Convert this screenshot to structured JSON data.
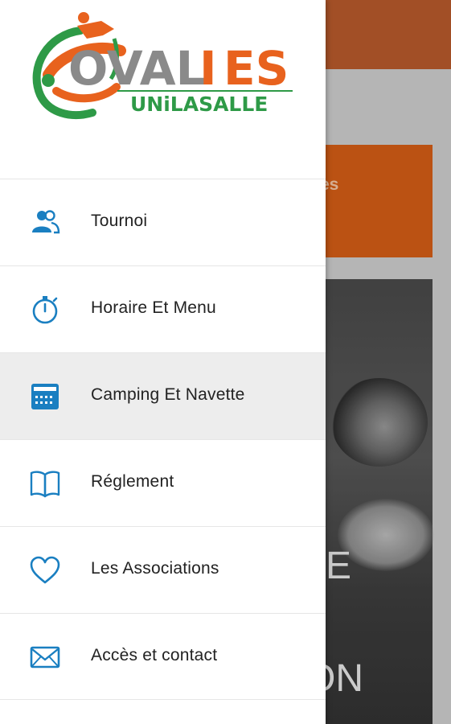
{
  "background": {
    "card_text": "es",
    "photo_text_1": "E",
    "photo_text_2": "ON"
  },
  "drawer": {
    "logo": {
      "wordmark": "OVALIES",
      "subline": "UNiLASALLE"
    },
    "items": [
      {
        "label": "Tournoi",
        "icon": "users-icon",
        "active": false
      },
      {
        "label": "Horaire Et Menu",
        "icon": "stopwatch-icon",
        "active": false
      },
      {
        "label": "Camping Et Navette",
        "icon": "calendar-icon",
        "active": true
      },
      {
        "label": "Réglement",
        "icon": "book-icon",
        "active": false
      },
      {
        "label": "Les Associations",
        "icon": "heart-icon",
        "active": false
      },
      {
        "label": "Accès et contact",
        "icon": "envelope-icon",
        "active": false
      }
    ]
  },
  "colors": {
    "icon_blue": "#1a7fc1",
    "logo_orange": "#e8621e",
    "logo_green": "#2e9a47",
    "logo_gray": "#8a8a8a",
    "appbar": "#b95a2c",
    "card_orange": "#d55e16",
    "active_row": "#ededed"
  }
}
